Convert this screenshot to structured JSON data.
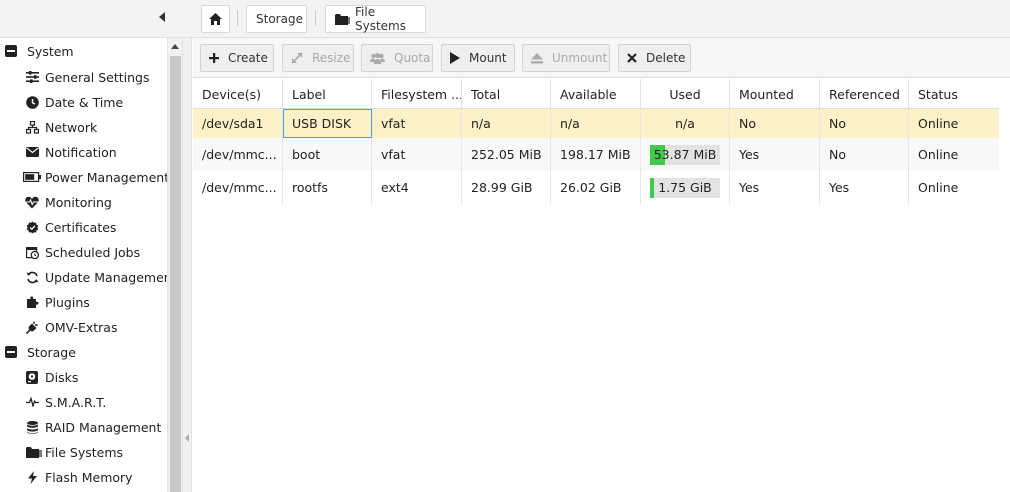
{
  "breadcrumb": {
    "home_icon": "home-icon",
    "items": [
      {
        "label": "Storage"
      },
      {
        "label": "File Systems",
        "icon": "folder-icon"
      }
    ]
  },
  "sidebar": {
    "groups": [
      {
        "label": "System",
        "items": [
          {
            "label": "General Settings",
            "icon": "sliders-icon"
          },
          {
            "label": "Date & Time",
            "icon": "clock-icon"
          },
          {
            "label": "Network",
            "icon": "network-icon"
          },
          {
            "label": "Notification",
            "icon": "envelope-icon"
          },
          {
            "label": "Power Management",
            "icon": "battery-icon"
          },
          {
            "label": "Monitoring",
            "icon": "heartbeat-icon"
          },
          {
            "label": "Certificates",
            "icon": "certificate-icon"
          },
          {
            "label": "Scheduled Jobs",
            "icon": "calendar-clock-icon"
          },
          {
            "label": "Update Management",
            "icon": "refresh-icon"
          },
          {
            "label": "Plugins",
            "icon": "puzzle-icon"
          },
          {
            "label": "OMV-Extras",
            "icon": "plug-icon"
          }
        ]
      },
      {
        "label": "Storage",
        "items": [
          {
            "label": "Disks",
            "icon": "disk-icon"
          },
          {
            "label": "S.M.A.R.T.",
            "icon": "pulse-icon"
          },
          {
            "label": "RAID Management",
            "icon": "database-icon"
          },
          {
            "label": "File Systems",
            "icon": "folder-icon"
          },
          {
            "label": "Flash Memory",
            "icon": "bolt-icon"
          }
        ]
      }
    ]
  },
  "toolbar": {
    "buttons": [
      {
        "label": "Create",
        "icon": "plus-icon",
        "enabled": true
      },
      {
        "label": "Resize",
        "icon": "resize-icon",
        "enabled": false
      },
      {
        "label": "Quota",
        "icon": "users-icon",
        "enabled": false
      },
      {
        "label": "Mount",
        "icon": "play-icon",
        "enabled": true
      },
      {
        "label": "Unmount",
        "icon": "eject-icon",
        "enabled": false
      },
      {
        "label": "Delete",
        "icon": "x-icon",
        "enabled": true
      }
    ]
  },
  "grid": {
    "columns": [
      "Device(s)",
      "Label",
      "Filesystem ...",
      "Total",
      "Available",
      "Used",
      "Mounted",
      "Referenced",
      "Status"
    ],
    "rows": [
      {
        "device": "/dev/sda1",
        "label": "USB DISK",
        "filesystem": "vfat",
        "total": "n/a",
        "available": "n/a",
        "used": "n/a",
        "used_fraction": null,
        "mounted": "No",
        "referenced": "No",
        "status": "Online",
        "selected": true
      },
      {
        "device": "/dev/mmc...",
        "label": "boot",
        "filesystem": "vfat",
        "total": "252.05 MiB",
        "available": "198.17 MiB",
        "used": "53.87 MiB",
        "used_fraction": 0.21,
        "mounted": "Yes",
        "referenced": "No",
        "status": "Online",
        "selected": false
      },
      {
        "device": "/dev/mmc...",
        "label": "rootfs",
        "filesystem": "ext4",
        "total": "28.99 GiB",
        "available": "26.02 GiB",
        "used": "1.75 GiB",
        "used_fraction": 0.06,
        "mounted": "Yes",
        "referenced": "Yes",
        "status": "Online",
        "selected": false
      }
    ]
  },
  "colors": {
    "selected_row": "#fdf1c7",
    "used_bar_fill": "#41c94b",
    "used_bar_bg": "#e3e3e3"
  }
}
